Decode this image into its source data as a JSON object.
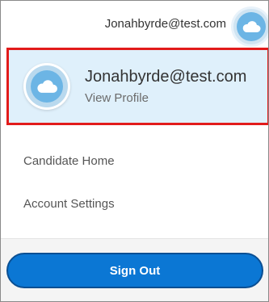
{
  "header": {
    "email": "Jonahbyrde@test.com",
    "avatar_icon": "cloud-icon"
  },
  "profile": {
    "name": "Jonahbyrde@test.com",
    "link_label": "View Profile",
    "avatar_icon": "cloud-icon"
  },
  "menu": {
    "items": [
      {
        "label": "Candidate Home"
      },
      {
        "label": "Account Settings"
      }
    ]
  },
  "footer": {
    "signout_label": "Sign Out"
  },
  "colors": {
    "accent": "#0b77d4",
    "highlight_border": "#e21b1b",
    "selected_background": "#dff0fb",
    "avatar_blue": "#6cb5e5"
  }
}
